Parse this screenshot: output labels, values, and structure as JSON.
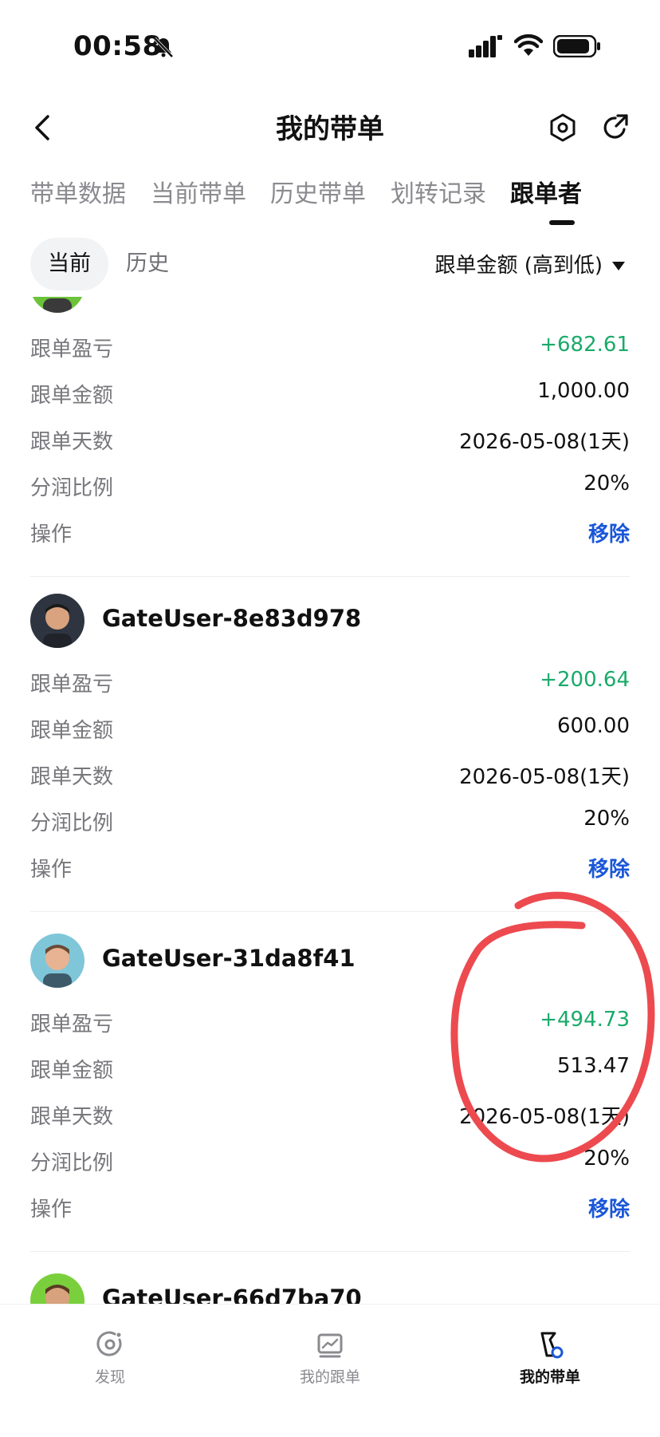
{
  "status_bar": {
    "time": "00:58"
  },
  "header": {
    "title": "我的带单"
  },
  "main_tabs": [
    {
      "label": "带单数据"
    },
    {
      "label": "当前带单"
    },
    {
      "label": "历史带单"
    },
    {
      "label": "划转记录"
    },
    {
      "label": "跟单者",
      "active": true
    }
  ],
  "sub_tabs": [
    {
      "label": "当前",
      "active": true
    },
    {
      "label": "历史"
    }
  ],
  "sort": {
    "label": "跟单金额 (高到低)"
  },
  "followers": [
    {
      "username": "",
      "rows": [
        {
          "label": "跟单盈亏",
          "value": "+682.61"
        },
        {
          "label": "跟单金额",
          "value": "1,000.00"
        },
        {
          "label": "跟单天数",
          "value": "2026-05-08(1天)"
        },
        {
          "label": "分润比例",
          "value": "20%"
        },
        {
          "label": "操作",
          "value": "移除"
        }
      ]
    },
    {
      "username": "GateUser-8e83d978",
      "rows": [
        {
          "label": "跟单盈亏",
          "value": "+200.64"
        },
        {
          "label": "跟单金额",
          "value": "600.00"
        },
        {
          "label": "跟单天数",
          "value": "2026-05-08(1天)"
        },
        {
          "label": "分润比例",
          "value": "20%"
        },
        {
          "label": "操作",
          "value": "移除"
        }
      ]
    },
    {
      "username": "GateUser-31da8f41",
      "rows": [
        {
          "label": "跟单盈亏",
          "value": "+494.73"
        },
        {
          "label": "跟单金额",
          "value": "513.47"
        },
        {
          "label": "跟单天数",
          "value": "2026-05-08(1天)"
        },
        {
          "label": "分润比例",
          "value": "20%"
        },
        {
          "label": "操作",
          "value": "移除"
        }
      ]
    },
    {
      "username": "GateUser-66d7ba70",
      "rows": []
    }
  ],
  "bottom_nav": [
    {
      "label": "发现",
      "icon": "discover-icon"
    },
    {
      "label": "我的跟单",
      "icon": "chart-icon"
    },
    {
      "label": "我的带单",
      "icon": "flag-icon",
      "active": true
    }
  ],
  "colors": {
    "positive": "#1aaa6a",
    "action": "#1a57d8",
    "annotation": "#ec4a4f"
  }
}
